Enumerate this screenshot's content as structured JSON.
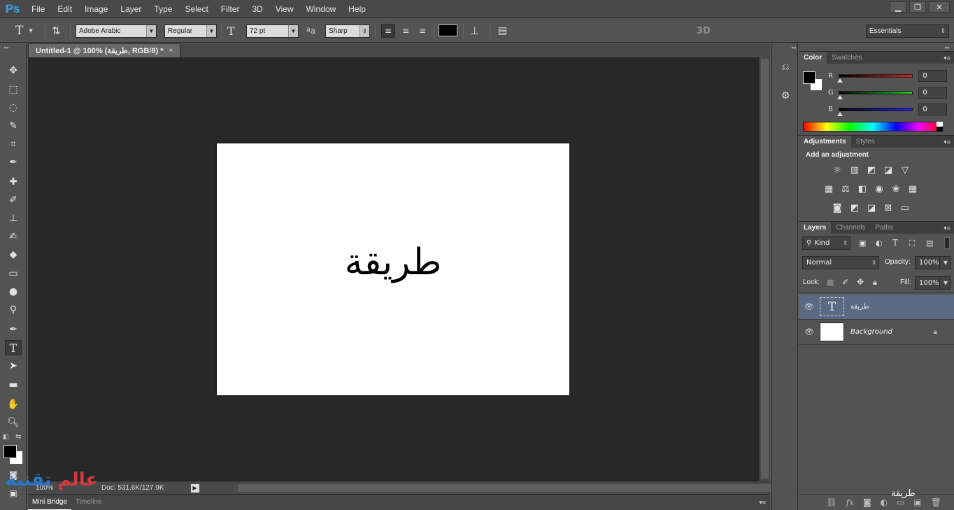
{
  "app": {
    "logo": "Ps"
  },
  "menu": [
    "File",
    "Edit",
    "Image",
    "Layer",
    "Type",
    "Select",
    "Filter",
    "3D",
    "View",
    "Window",
    "Help"
  ],
  "window_controls": {
    "minimize": "▁",
    "restore": "❐",
    "close": "✕"
  },
  "options": {
    "tool_icon": "T",
    "font_family": "Adobe Arabic",
    "font_style": "Regular",
    "font_size": "72 pt",
    "antialias_icon": "ªa",
    "antialias": "Sharp",
    "label_3d": "3D",
    "workspace": "Essentials"
  },
  "document": {
    "tab_title": "Untitled-1 @ 100% (طريقة, RGB/8) *",
    "tab_close": "×",
    "canvas_text": "طريقة",
    "zoom": "100%",
    "doc_info": "Doc: 531.6K/127.9K",
    "status_arrow": "▶"
  },
  "bottom_tabs": [
    "Mini Bridge",
    "Timeline"
  ],
  "color_panel": {
    "tabs": [
      "Color",
      "Swatches"
    ],
    "fg": "#000000",
    "bg": "#ffffff",
    "channels": [
      {
        "label": "R",
        "value": "0",
        "color": "#e02020"
      },
      {
        "label": "G",
        "value": "0",
        "color": "#20c020"
      },
      {
        "label": "B",
        "value": "0",
        "color": "#2020e0"
      }
    ]
  },
  "adjustments_panel": {
    "tabs": [
      "Adjustments",
      "Styles"
    ],
    "heading": "Add an adjustment",
    "icons": [
      [
        "brightness-icon",
        "levels-icon",
        "curves-icon",
        "exposure-icon",
        "vibrance-icon"
      ],
      [
        "hue-sat-icon",
        "color-balance-icon",
        "bw-icon",
        "photo-filter-icon",
        "channel-mixer-icon",
        "color-lookup-icon"
      ],
      [
        "invert-icon",
        "posterize-icon",
        "threshold-icon",
        "selective-color-icon",
        "gradient-map-icon"
      ]
    ]
  },
  "layers_panel": {
    "tabs": [
      "Layers",
      "Channels",
      "Paths"
    ],
    "filter_kind": "Kind",
    "blend_mode": "Normal",
    "opacity_label": "Opacity:",
    "opacity": "100%",
    "lock_label": "Lock:",
    "fill_label": "Fill:",
    "fill": "100%",
    "layers": [
      {
        "name": "طريقة",
        "type": "text",
        "thumb": "T",
        "selected": true
      },
      {
        "name": "Background",
        "type": "background",
        "thumb": "",
        "selected": false
      }
    ]
  },
  "watermarks": {
    "left_red": "عالم",
    "left_blue": "تقنية",
    "right": "طريقة"
  }
}
